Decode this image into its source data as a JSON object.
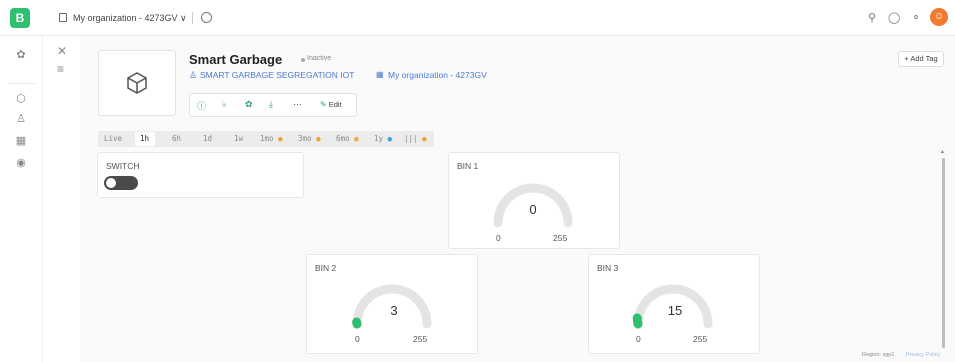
{
  "topbar": {
    "logo_letter": "B",
    "org_name": "My organization - 4273GV ∨",
    "icons": [
      "chat-icon",
      "support-icon",
      "notification-icon",
      "user-avatar"
    ],
    "avatar_letter": "☺"
  },
  "device": {
    "title": "Smart Garbage",
    "status": "Inactive",
    "template": "SMART GARBAGE SEGREGATION IOT",
    "organization": "My organization - 4273GV",
    "edit_label": "Edit",
    "add_tag_label": "+ Add Tag"
  },
  "time_tabs": [
    {
      "label": "Live",
      "active": false
    },
    {
      "label": "1h",
      "active": true
    },
    {
      "label": "6h",
      "active": false
    },
    {
      "label": "1d",
      "active": false
    },
    {
      "label": "1w",
      "active": false
    },
    {
      "label": "1mo",
      "active": false,
      "dot": "orange"
    },
    {
      "label": "3mo",
      "active": false,
      "dot": "orange"
    },
    {
      "label": "6mo",
      "active": false,
      "dot": "orange"
    },
    {
      "label": "1y",
      "active": false,
      "dot": "blue"
    },
    {
      "label": "|||",
      "active": false,
      "dot": "orange"
    }
  ],
  "widgets": {
    "switch": {
      "title": "SWITCH",
      "state": "off"
    },
    "bin1": {
      "title": "BIN 1",
      "value": "0",
      "min": "0",
      "max": "255"
    },
    "bin2": {
      "title": "BIN 2",
      "value": "3",
      "min": "0",
      "max": "255"
    },
    "bin3": {
      "title": "BIN 3",
      "value": "15",
      "min": "0",
      "max": "255"
    }
  },
  "footer": {
    "region": "Region: sgp1",
    "privacy": "Privacy Policy"
  },
  "colors": {
    "brand_green": "#2fbf71",
    "gauge_track": "#e4e4e4",
    "gauge_fill": "#2fbf71",
    "link_blue": "#4a7bd0"
  }
}
